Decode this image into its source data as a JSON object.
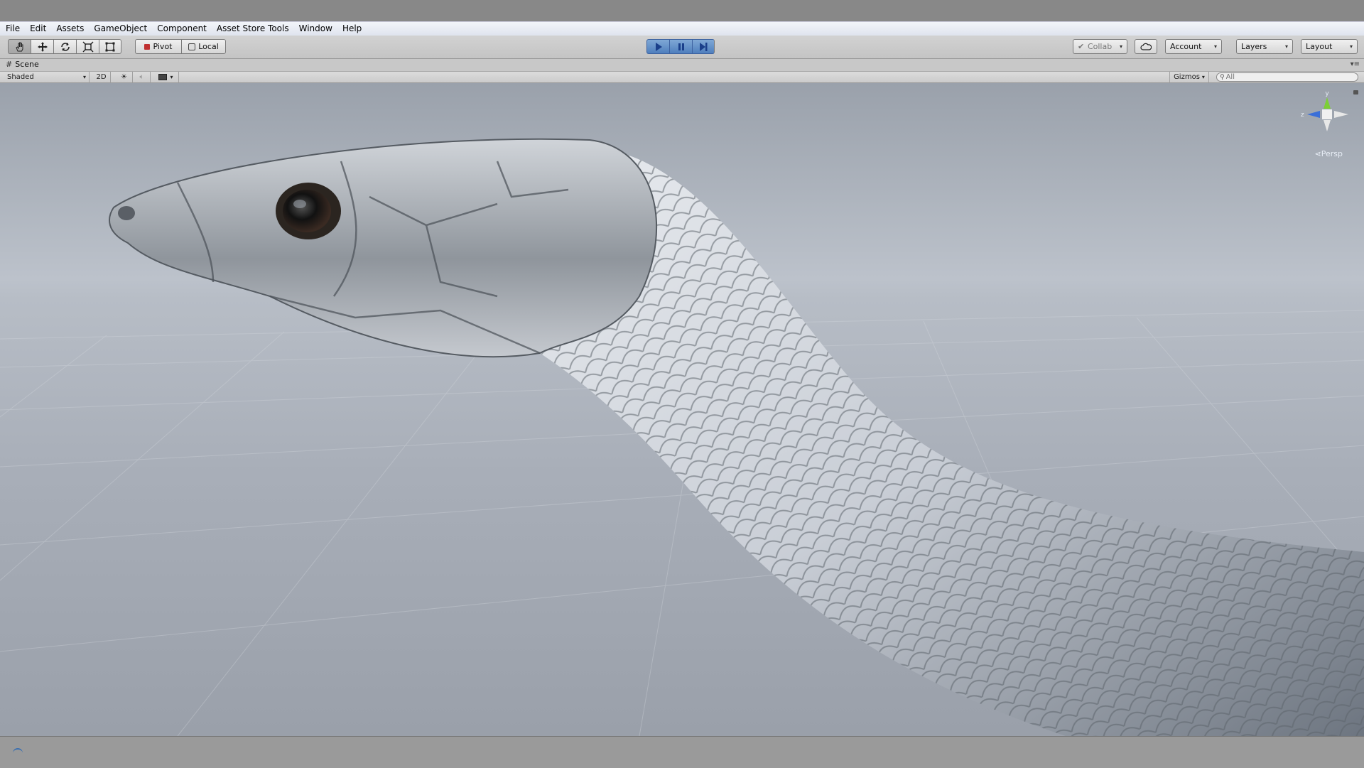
{
  "menu": [
    "File",
    "Edit",
    "Assets",
    "GameObject",
    "Component",
    "Asset Store Tools",
    "Window",
    "Help"
  ],
  "toolbar": {
    "pivot_label": "Pivot",
    "local_label": "Local",
    "collab_label": "Collab",
    "account_label": "Account",
    "layers_label": "Layers",
    "layout_label": "Layout"
  },
  "scene": {
    "tab_label": "Scene",
    "shading_mode": "Shaded",
    "mode_2d": "2D",
    "gizmos_label": "Gizmos",
    "search_placeholder": "All",
    "projection_label": "Persp",
    "axis_y": "y",
    "axis_z": "z"
  },
  "colors": {
    "accent_play": "#4f7fbd",
    "axis_y": "#7ccf35",
    "axis_z": "#3b6fd8"
  },
  "icons": {
    "hand": "hand-tool-icon",
    "move": "move-tool-icon",
    "rotate": "rotate-tool-icon",
    "scale": "scale-tool-icon",
    "rect": "rect-tool-icon",
    "play": "play-icon",
    "pause": "pause-icon",
    "step": "step-icon",
    "cloud": "cloud-icon"
  }
}
